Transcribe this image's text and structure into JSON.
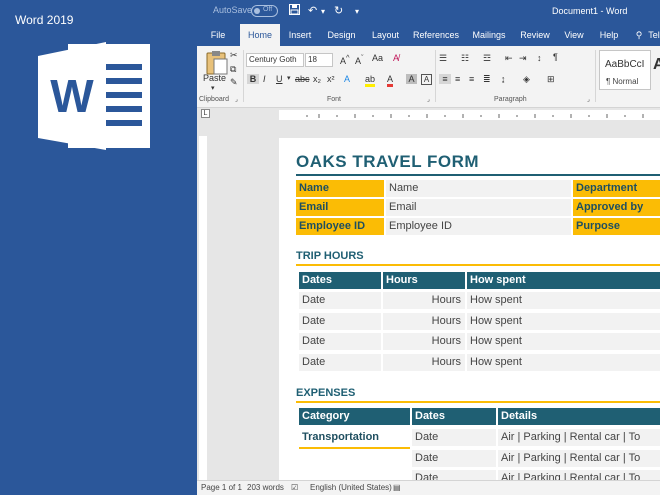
{
  "promo": {
    "title": "Word 2019",
    "logo_letter": "W"
  },
  "titlebar": {
    "autosave_label": "AutoSave",
    "autosave_state": "Off",
    "doc_title": "Document1 - Word"
  },
  "tabs": [
    "File",
    "Home",
    "Insert",
    "Design",
    "Layout",
    "References",
    "Mailings",
    "Review",
    "View",
    "Help",
    "Tell"
  ],
  "ribbon": {
    "paste_label": "Paste",
    "font_name": "Century Goth",
    "font_size": "18",
    "styles_sample": "AaBbCcI",
    "styles_name": "¶ Normal",
    "groups": {
      "clipboard": "Clipboard",
      "font": "Font",
      "paragraph": "Paragraph"
    }
  },
  "form": {
    "title": "OAKS TRAVEL FORM",
    "info_rows": [
      {
        "label": "Name",
        "value": "Name",
        "right_label": "Department"
      },
      {
        "label": "Email",
        "value": "Email",
        "right_label": "Approved by"
      },
      {
        "label": "Employee ID",
        "value": "Employee ID",
        "right_label": "Purpose"
      }
    ],
    "trip": {
      "heading": "TRIP HOURS",
      "headers": [
        "Dates",
        "Hours",
        "How spent"
      ],
      "rows": [
        [
          "Date",
          "Hours",
          "How spent"
        ],
        [
          "Date",
          "Hours",
          "How spent"
        ],
        [
          "Date",
          "Hours",
          "How spent"
        ],
        [
          "Date",
          "Hours",
          "How spent"
        ]
      ]
    },
    "expenses": {
      "heading": "EXPENSES",
      "headers": [
        "Category",
        "Dates",
        "Details"
      ],
      "rows": [
        [
          "Transportation",
          "Date",
          "Air | Parking | Rental car | To"
        ],
        [
          "",
          "Date",
          "Air | Parking | Rental car | To"
        ],
        [
          "",
          "Date",
          "Air | Parking | Rental car | To"
        ]
      ]
    }
  },
  "status": {
    "page": "Page 1 of 1",
    "words": "203 words",
    "language": "English (United States)"
  },
  "colors": {
    "word_blue": "#2b579a",
    "teal": "#1f5f73",
    "gold": "#fbbc05"
  }
}
